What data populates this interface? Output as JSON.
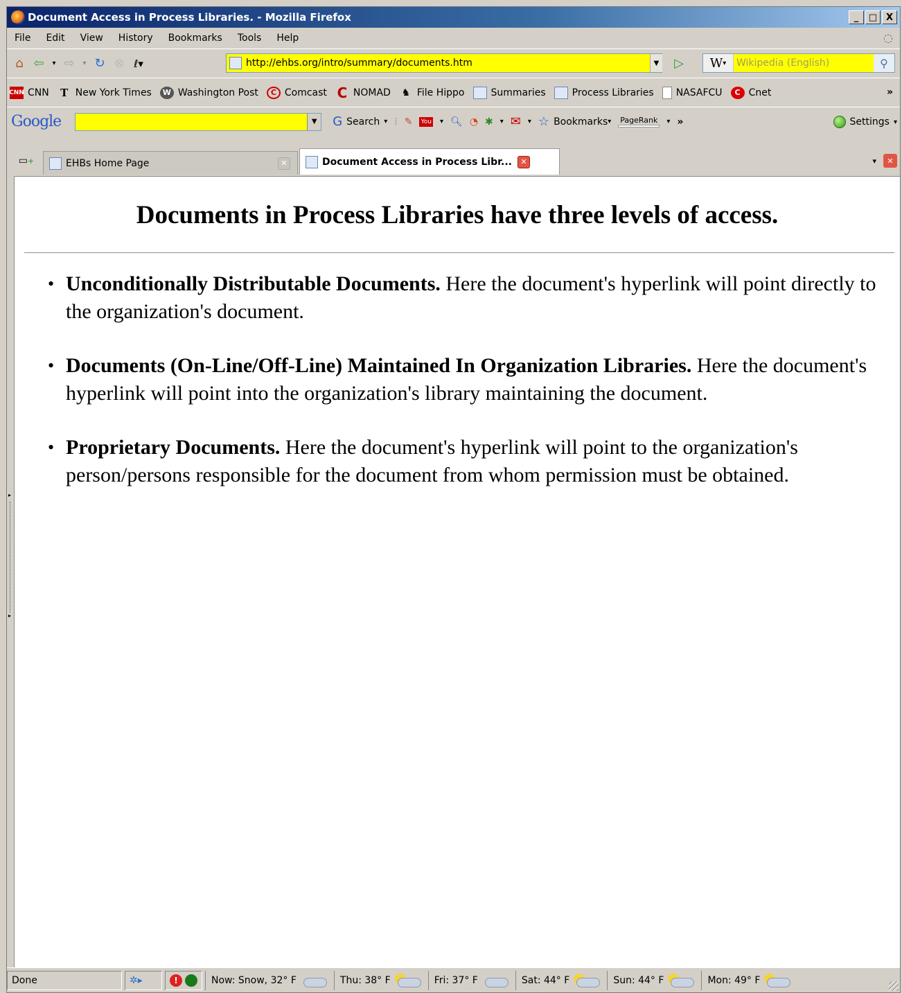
{
  "window": {
    "title": "Document Access in Process Libraries. - Mozilla Firefox",
    "min": "_",
    "max": "□",
    "close": "X"
  },
  "menu": [
    "File",
    "Edit",
    "View",
    "History",
    "Bookmarks",
    "Tools",
    "Help"
  ],
  "nav": {
    "url": "http://ehbs.org/intro/summary/documents.htm",
    "search_engine": "W",
    "search_placeholder": "Wikipedia (English)"
  },
  "bookmarks": [
    {
      "label": "CNN",
      "icon": "cnn-icon"
    },
    {
      "label": "New York Times",
      "icon": "nyt-icon"
    },
    {
      "label": "Washington Post",
      "icon": "wapo-icon"
    },
    {
      "label": "Comcast",
      "icon": "comcast-icon"
    },
    {
      "label": "NOMAD",
      "icon": "nomad-icon"
    },
    {
      "label": "File Hippo",
      "icon": "filehippo-icon"
    },
    {
      "label": "Summaries",
      "icon": "page-icon"
    },
    {
      "label": "Process Libraries",
      "icon": "page-icon"
    },
    {
      "label": "NASAFCU",
      "icon": "blank-page-icon"
    },
    {
      "label": "Cnet",
      "icon": "cnet-icon"
    }
  ],
  "bookmarks_more": "»",
  "google_bar": {
    "logo": "Google",
    "search_label": "Search",
    "bookmarks_label": "Bookmarks",
    "pagerank_label": "PageRank",
    "more": "»",
    "settings_label": "Settings"
  },
  "tabs": [
    {
      "label": "EHBs Home Page",
      "active": false
    },
    {
      "label": "Document Access in Process Libr...",
      "active": true
    }
  ],
  "page": {
    "heading": "Documents in Process Libraries have three levels of access.",
    "items": [
      {
        "bold": "Unconditionally Distributable Documents.",
        "text": " Here the document's hyperlink will point directly to the organization's document."
      },
      {
        "bold": "Documents (On-Line/Off-Line) Maintained In Organization Libraries.",
        "text": " Here the document's hyperlink will point into the organization's library maintaining the document."
      },
      {
        "bold": "Proprietary Documents.",
        "text": " Here the document's hyperlink will point to the organization's person/persons responsible for the document from whom permission must be obtained."
      }
    ]
  },
  "status": {
    "text": "Done",
    "weather": [
      {
        "label": "Now: Snow, 32° F",
        "icon": "snow-cloud-icon"
      },
      {
        "label": "Thu: 38° F",
        "icon": "partly-cloudy-icon"
      },
      {
        "label": "Fri: 37° F",
        "icon": "snow-cloud-icon"
      },
      {
        "label": "Sat: 44° F",
        "icon": "partly-cloudy-icon"
      },
      {
        "label": "Sun: 44° F",
        "icon": "partly-cloudy-icon"
      },
      {
        "label": "Mon: 49° F",
        "icon": "partly-cloudy-icon"
      }
    ]
  }
}
